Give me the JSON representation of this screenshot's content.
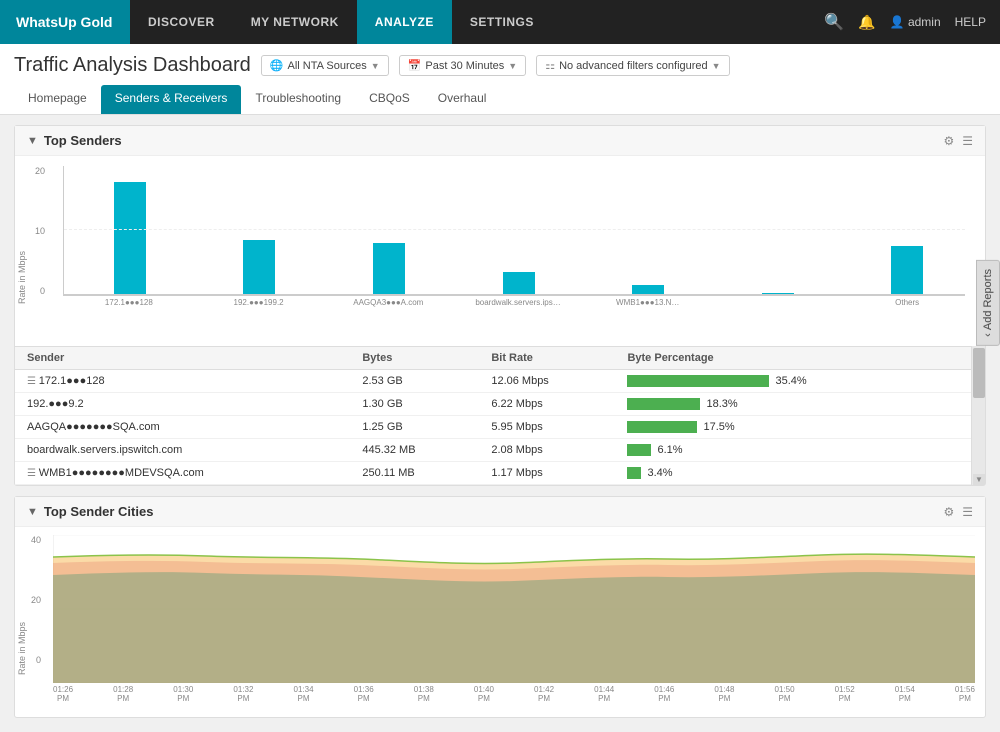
{
  "app": {
    "logo": "WhatsUp Gold"
  },
  "nav": {
    "items": [
      {
        "id": "discover",
        "label": "DISCOVER",
        "active": false
      },
      {
        "id": "my-network",
        "label": "MY NETWORK",
        "active": false
      },
      {
        "id": "analyze",
        "label": "ANALYZE",
        "active": true
      },
      {
        "id": "settings",
        "label": "SETTINGS",
        "active": false
      }
    ],
    "user": "admin",
    "help": "HELP"
  },
  "page": {
    "title": "Traffic Analysis Dashboard",
    "filters": {
      "sources": "All NTA Sources",
      "time": "Past 30 Minutes",
      "advanced": "No advanced filters configured"
    },
    "tabs": [
      {
        "id": "homepage",
        "label": "Homepage",
        "active": false
      },
      {
        "id": "senders-receivers",
        "label": "Senders & Receivers",
        "active": true
      },
      {
        "id": "troubleshooting",
        "label": "Troubleshooting",
        "active": false
      },
      {
        "id": "cbqos",
        "label": "CBQoS",
        "active": false
      },
      {
        "id": "overhaul",
        "label": "Overhaul",
        "active": false
      }
    ]
  },
  "top_senders": {
    "title": "Top Senders",
    "bars": [
      {
        "label": "172.1●●●128",
        "height_pct": 87
      },
      {
        "label": "192.●●●199.2",
        "height_pct": 42
      },
      {
        "label": "AAGQA3●●●A.com",
        "height_pct": 40
      },
      {
        "label": "boardwalk.servers.ips…",
        "height_pct": 18
      },
      {
        "label": "WMB1●●●13.N…",
        "height_pct": 8
      },
      {
        "label": "",
        "height_pct": 0
      },
      {
        "label": "Others",
        "height_pct": 38
      }
    ],
    "y_axis": {
      "max": 20,
      "mid": 10,
      "min": 0,
      "label": "Rate in Mbps"
    },
    "columns": [
      "Sender",
      "Bytes",
      "Bit Rate",
      "Byte Percentage"
    ],
    "rows": [
      {
        "icon": true,
        "sender": "172.1●●●128",
        "bytes": "2.53 GB",
        "bit_rate": "12.06 Mbps",
        "pct": 35.4,
        "pct_label": "35.4%"
      },
      {
        "icon": false,
        "sender": "192.●●●9.2",
        "bytes": "1.30 GB",
        "bit_rate": "6.22 Mbps",
        "pct": 18.3,
        "pct_label": "18.3%"
      },
      {
        "icon": false,
        "sender": "AAGQA●●●●●●●SQA.com",
        "bytes": "1.25 GB",
        "bit_rate": "5.95 Mbps",
        "pct": 17.5,
        "pct_label": "17.5%"
      },
      {
        "icon": false,
        "sender": "boardwalk.servers.ipswitch.com",
        "bytes": "445.32 MB",
        "bit_rate": "2.08 Mbps",
        "pct": 6.1,
        "pct_label": "6.1%"
      },
      {
        "icon": true,
        "sender": "WMB1●●●●●●●●MDEVSQA.com",
        "bytes": "250.11 MB",
        "bit_rate": "1.17 Mbps",
        "pct": 3.4,
        "pct_label": "3.4%"
      }
    ]
  },
  "top_sender_cities": {
    "title": "Top Sender Cities",
    "y_axis": {
      "max": 40,
      "mid": 20,
      "min": 0,
      "label": "Rate in Mbps"
    },
    "x_labels": [
      "01:26\nPM",
      "01:28\nPM",
      "01:30\nPM",
      "01:32\nPM",
      "01:34\nPM",
      "01:36\nPM",
      "01:38\nPM",
      "01:40\nPM",
      "01:42\nPM",
      "01:44\nPM",
      "01:46\nPM",
      "01:48\nPM",
      "01:50\nPM",
      "01:52\nPM",
      "01:54\nPM",
      "01:56\nPM"
    ]
  },
  "add_reports_label": "Add Reports"
}
